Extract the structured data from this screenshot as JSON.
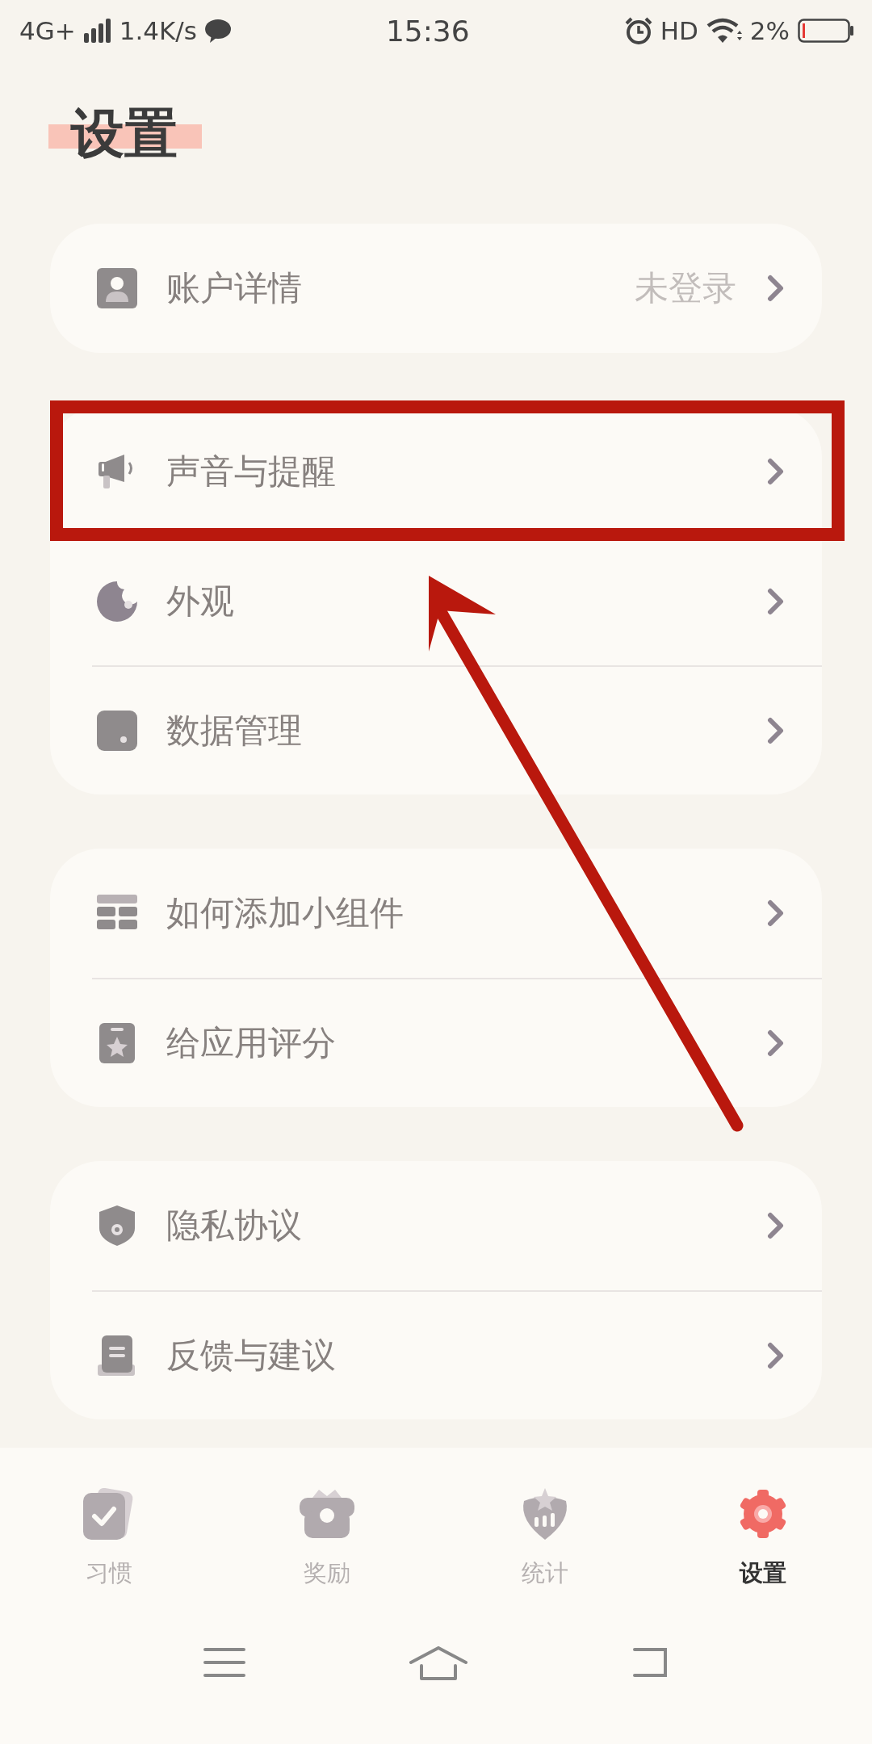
{
  "status_bar": {
    "network": "4G+",
    "speed": "1.4K/s",
    "time": "15:36",
    "hd": "HD",
    "battery": "2%"
  },
  "title": "设置",
  "groups": [
    {
      "rows": [
        {
          "kind": "account",
          "label": "账户详情",
          "value": "未登录",
          "highlighted": false
        }
      ]
    },
    {
      "rows": [
        {
          "kind": "sound",
          "label": "声音与提醒",
          "highlighted": true
        },
        {
          "kind": "appearance",
          "label": "外观",
          "highlighted": false
        },
        {
          "kind": "data",
          "label": "数据管理",
          "highlighted": false
        }
      ]
    },
    {
      "rows": [
        {
          "kind": "widget",
          "label": "如何添加小组件",
          "highlighted": false
        },
        {
          "kind": "rate",
          "label": "给应用评分",
          "highlighted": false
        }
      ]
    },
    {
      "rows": [
        {
          "kind": "privacy",
          "label": "隐私协议",
          "highlighted": false
        },
        {
          "kind": "feedback",
          "label": "反馈与建议",
          "highlighted": false
        }
      ]
    }
  ],
  "tabs": [
    {
      "kind": "habit",
      "label": "习惯",
      "selected": false
    },
    {
      "kind": "reward",
      "label": "奖励",
      "selected": false
    },
    {
      "kind": "stats",
      "label": "统计",
      "selected": false
    },
    {
      "kind": "settings",
      "label": "设置",
      "selected": true
    }
  ]
}
